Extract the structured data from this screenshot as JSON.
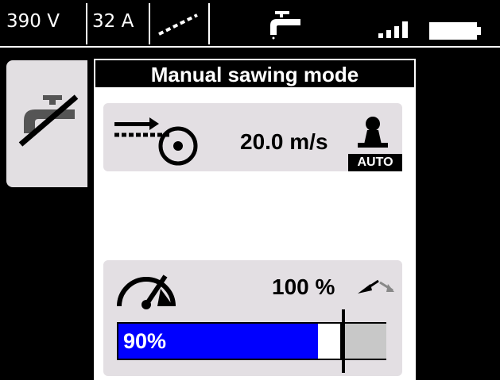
{
  "status_bar": {
    "voltage": "390 V",
    "current": "32 A",
    "link_icon": "dotted-cable-link-icon",
    "water_icon": "water-tap-icon",
    "signal_icon": "signal-strength-icon",
    "battery_icon": "battery-full-icon"
  },
  "side_tab": {
    "icon": "water-off-icon"
  },
  "panel": {
    "title": "Manual sawing mode",
    "feed": {
      "icon": "blade-feed-icon",
      "value": "20.0 m/s",
      "mode_icon": "operator-icon",
      "mode_badge": "AUTO"
    },
    "power": {
      "icon": "speedometer-icon",
      "value": "100 %",
      "adjust_icon": "power-adjust-icon",
      "progress_label": "90%",
      "progress_fraction": 0.9
    }
  },
  "colors": {
    "background": "#000000",
    "panel": "#ffffff",
    "card": "#e3dfe3",
    "progress": "#0000ff",
    "reserve": "#c8c8c8"
  }
}
